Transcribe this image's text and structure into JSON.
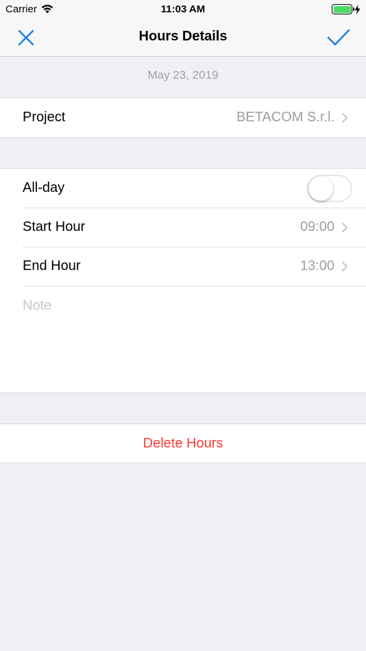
{
  "status_bar": {
    "carrier": "Carrier",
    "time": "11:03 AM",
    "battery_color": "#4cd964"
  },
  "nav": {
    "title": "Hours Details",
    "close_icon": "close-x-icon",
    "done_icon": "checkmark-icon",
    "tint_color": "#1a7fe0"
  },
  "date_header": "May 23, 2019",
  "project": {
    "label": "Project",
    "value": "BETACOM S.r.l."
  },
  "all_day": {
    "label": "All-day",
    "on": false
  },
  "start_hour": {
    "label": "Start Hour",
    "value": "09:00"
  },
  "end_hour": {
    "label": "End Hour",
    "value": "13:00"
  },
  "note": {
    "placeholder": "Note"
  },
  "delete": {
    "label": "Delete Hours",
    "color": "#ff3b30"
  }
}
